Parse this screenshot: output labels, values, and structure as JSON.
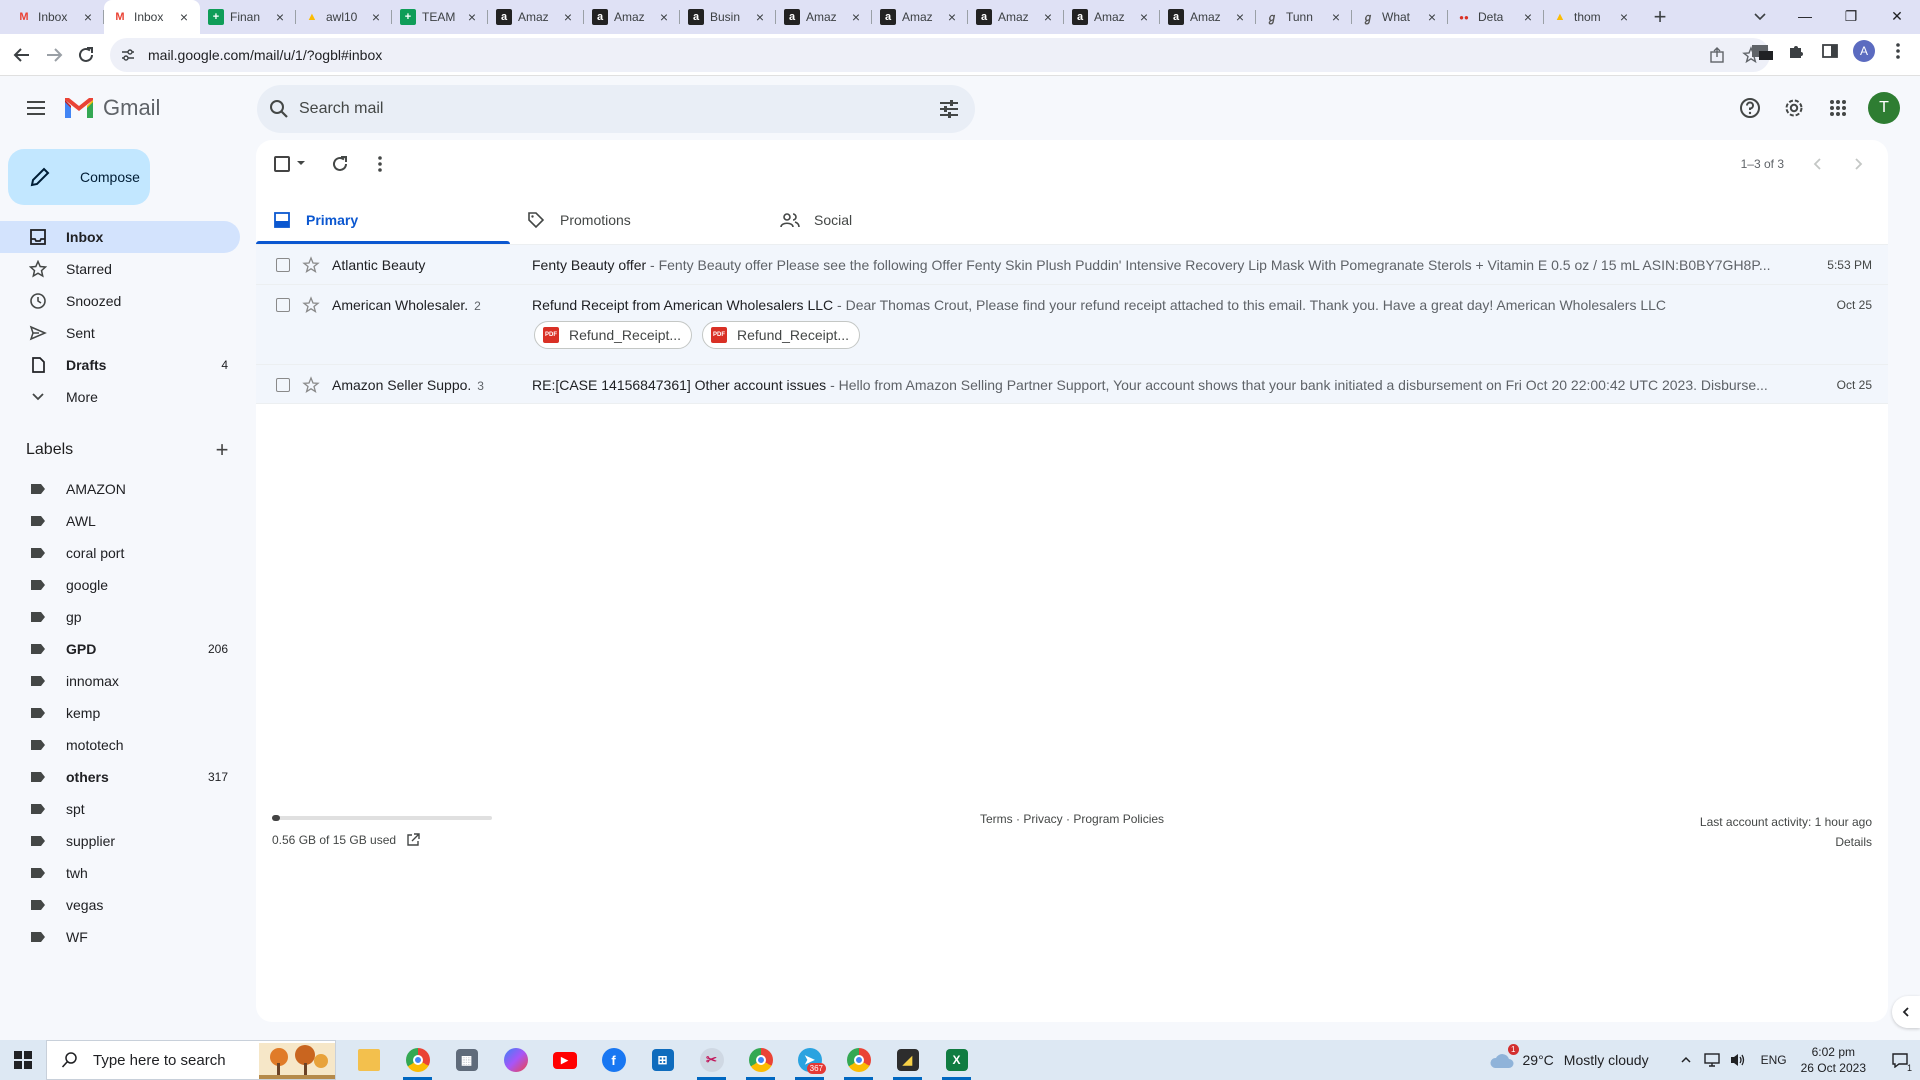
{
  "browser": {
    "tabs": [
      {
        "label": "Inbox",
        "icon": "gmail-icon",
        "active": false
      },
      {
        "label": "Inbox",
        "icon": "gmail-icon",
        "active": true
      },
      {
        "label": "Finan",
        "icon": "sheets-icon",
        "active": false
      },
      {
        "label": "awl10",
        "icon": "drive-icon",
        "active": false
      },
      {
        "label": "TEAM",
        "icon": "sheets-icon",
        "active": false
      },
      {
        "label": "Amaz",
        "icon": "amazon-icon",
        "active": false
      },
      {
        "label": "Amaz",
        "icon": "amazon-icon",
        "active": false
      },
      {
        "label": "Busin",
        "icon": "amazon-icon",
        "active": false
      },
      {
        "label": "Amaz",
        "icon": "amazon-icon",
        "active": false
      },
      {
        "label": "Amaz",
        "icon": "amazon-icon",
        "active": false
      },
      {
        "label": "Amaz",
        "icon": "amazon-icon",
        "active": false
      },
      {
        "label": "Amaz",
        "icon": "amazon-icon",
        "active": false
      },
      {
        "label": "Amaz",
        "icon": "amazon-icon",
        "active": false
      },
      {
        "label": "Tunn",
        "icon": "link-icon",
        "active": false
      },
      {
        "label": "What",
        "icon": "link-icon",
        "active": false
      },
      {
        "label": "Deta",
        "icon": "site-icon",
        "active": false
      },
      {
        "label": "thom",
        "icon": "drive-icon",
        "active": false
      }
    ],
    "url": "mail.google.com/mail/u/1/?ogbl#inbox",
    "profile_initial": "A"
  },
  "gmail": {
    "wordmark": "Gmail",
    "search_placeholder": "Search mail",
    "avatar_initial": "T",
    "compose_label": "Compose",
    "nav": [
      {
        "label": "Inbox",
        "icon": "inbox-icon",
        "count": "",
        "active": true,
        "bold": true
      },
      {
        "label": "Starred",
        "icon": "star-icon",
        "count": "",
        "active": false,
        "bold": false
      },
      {
        "label": "Snoozed",
        "icon": "clock-icon",
        "count": "",
        "active": false,
        "bold": false
      },
      {
        "label": "Sent",
        "icon": "send-icon",
        "count": "",
        "active": false,
        "bold": false
      },
      {
        "label": "Drafts",
        "icon": "draft-icon",
        "count": "4",
        "active": false,
        "bold": true
      },
      {
        "label": "More",
        "icon": "chevron-down-icon",
        "count": "",
        "active": false,
        "bold": false
      }
    ],
    "labels_heading": "Labels",
    "labels": [
      {
        "label": "AMAZON",
        "count": "",
        "bold": false
      },
      {
        "label": "AWL",
        "count": "",
        "bold": false
      },
      {
        "label": "coral port",
        "count": "",
        "bold": false
      },
      {
        "label": "google",
        "count": "",
        "bold": false
      },
      {
        "label": "gp",
        "count": "",
        "bold": false
      },
      {
        "label": "GPD",
        "count": "206",
        "bold": true
      },
      {
        "label": "innomax",
        "count": "",
        "bold": false
      },
      {
        "label": "kemp",
        "count": "",
        "bold": false
      },
      {
        "label": "mototech",
        "count": "",
        "bold": false
      },
      {
        "label": "others",
        "count": "317",
        "bold": true
      },
      {
        "label": "spt",
        "count": "",
        "bold": false
      },
      {
        "label": "supplier",
        "count": "",
        "bold": false
      },
      {
        "label": "twh",
        "count": "",
        "bold": false
      },
      {
        "label": "vegas",
        "count": "",
        "bold": false
      },
      {
        "label": "WF",
        "count": "",
        "bold": false
      }
    ],
    "pagination": "1–3 of 3",
    "tabs": [
      {
        "label": "Primary",
        "icon": "inbox-tab-icon",
        "active": true
      },
      {
        "label": "Promotions",
        "icon": "tag-icon",
        "active": false
      },
      {
        "label": "Social",
        "icon": "people-icon",
        "active": false
      }
    ],
    "emails": [
      {
        "sender": "Atlantic Beauty",
        "count": "",
        "subject": "Fenty Beauty offer",
        "snippet": " - Fenty Beauty offer Please see the following Offer Fenty Skin Plush Puddin' Intensive Recovery Lip Mask With Pomegranate Sterols + Vitamin E 0.5 oz / 15 mL ASIN:B0BY7GH8P...",
        "date": "5:53 PM"
      },
      {
        "sender": "American Wholesaler.",
        "count": "2",
        "subject": "Refund Receipt from American Wholesalers LLC",
        "snippet": " - Dear Thomas Crout, Please find your refund receipt attached to this email. Thank you. Have a great day! American Wholesalers LLC",
        "date": "Oct 25",
        "attachments": [
          "Refund_Receipt...",
          "Refund_Receipt..."
        ]
      },
      {
        "sender": "Amazon Seller Suppo.",
        "count": "3",
        "subject": "RE:[CASE 14156847361] Other account issues",
        "snippet": " - Hello from Amazon Selling Partner Support, Your account shows that your bank initiated a disbursement on Fri Oct 20 22:00:42 UTC 2023. Disburse...",
        "date": "Oct 25"
      }
    ],
    "storage_text": "0.56 GB of 15 GB used",
    "storage_fraction": 0.037,
    "footer_links": [
      "Terms",
      "Privacy",
      "Program Policies"
    ],
    "last_activity": "Last account activity: 1 hour ago",
    "details_link": "Details"
  },
  "taskbar": {
    "search_placeholder": "Type here to search",
    "temperature": "29°C",
    "weather": "Mostly cloudy",
    "language": "ENG",
    "time": "6:02 pm",
    "date": "26 Oct 2023",
    "telegram_badge": "367",
    "weather_badge": "1",
    "notification_count": "1"
  },
  "colors": {
    "gmail_red": "#ea4335",
    "accent_blue": "#0b57d0",
    "compose_bg": "#c2e7ff",
    "nav_active_bg": "#d3e3fd"
  }
}
